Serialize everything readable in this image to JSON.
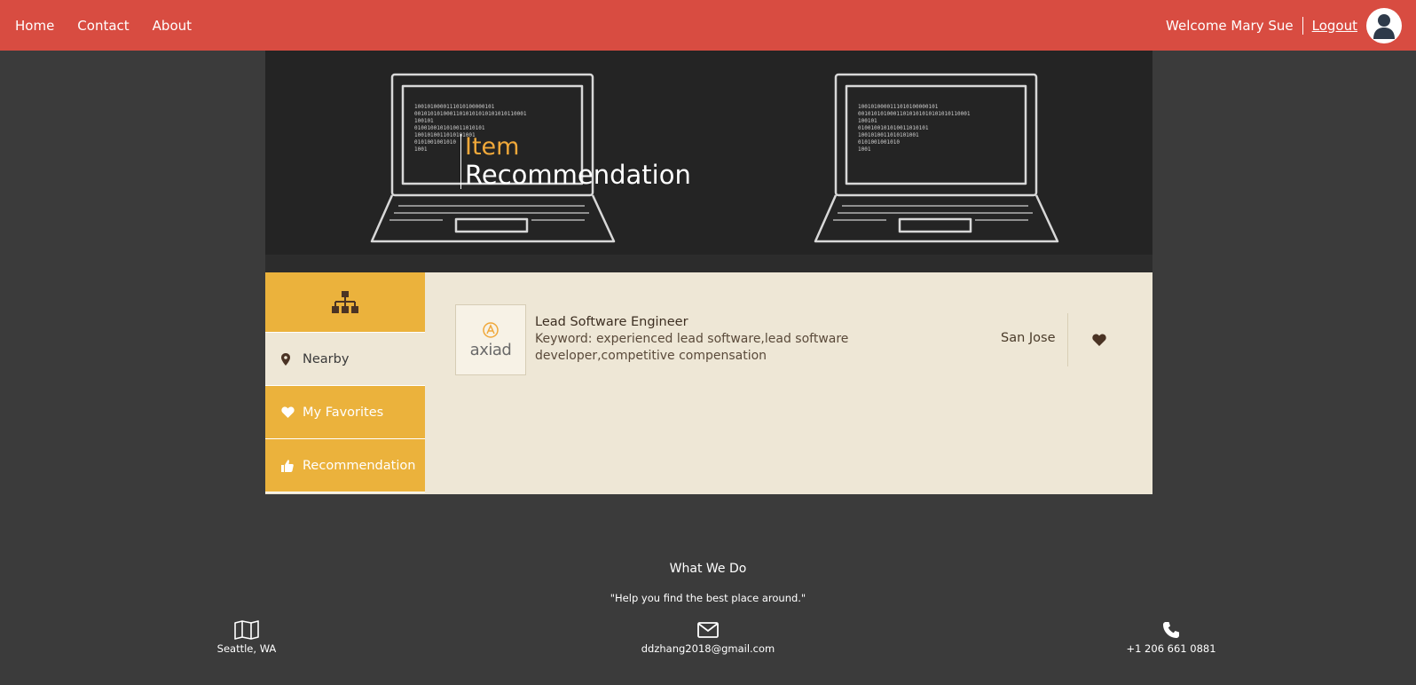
{
  "nav": {
    "links": [
      "Home",
      "Contact",
      "About"
    ]
  },
  "user": {
    "welcome": "Welcome Mary Sue",
    "logout": "Logout",
    "avatar_icon": "user-avatar-icon"
  },
  "hero": {
    "title_line1": "Item",
    "title_line2": "Recommendation"
  },
  "sidebar": {
    "header_icon": "sitemap-icon",
    "items": [
      {
        "label": "Nearby",
        "icon": "map-pin-icon",
        "active": false
      },
      {
        "label": "My Favorites",
        "icon": "heart-icon",
        "active": true
      },
      {
        "label": "Recommendation",
        "icon": "thumbs-up-icon",
        "active": true
      }
    ]
  },
  "results": [
    {
      "logo_text": "axiad",
      "title": "Lead Software Engineer",
      "keywords": "Keyword: experienced lead software,lead software developer,competitive compensation",
      "city": "San Jose",
      "favorite_icon": "heart-icon"
    }
  ],
  "footer": {
    "title": "What We Do",
    "quote": "\"Help you find the best place around.\"",
    "location": "Seattle, WA",
    "email": "ddzhang2018@gmail.com",
    "phone": "+1 206 661 0881"
  },
  "colors": {
    "topbar": "#d84c41",
    "accent": "#ebb23c",
    "panel": "#eee7d6",
    "background": "#3b3b3b",
    "hero_title_accent": "#f0a83a"
  }
}
